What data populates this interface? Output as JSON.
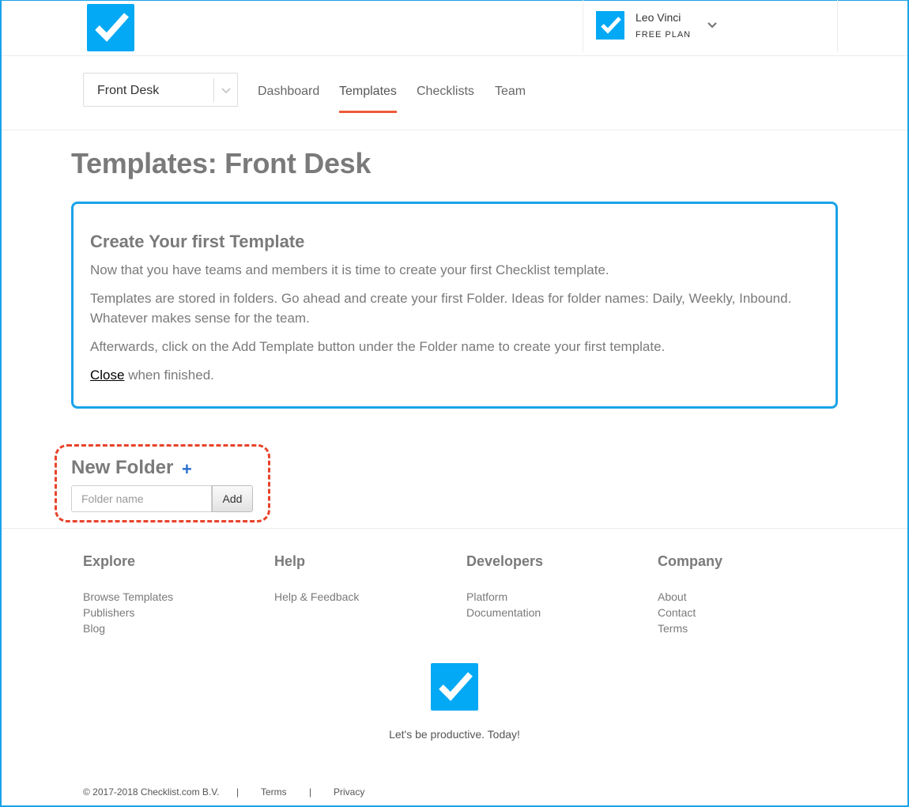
{
  "header": {
    "logo_icon": "checkmark-logo-icon",
    "user": {
      "name": "Leo Vinci",
      "plan": "FREE PLAN"
    }
  },
  "subnav": {
    "team_select": {
      "value": "Front Desk"
    },
    "tabs": [
      {
        "label": "Dashboard",
        "active": false
      },
      {
        "label": "Templates",
        "active": true
      },
      {
        "label": "Checklists",
        "active": false
      },
      {
        "label": "Team",
        "active": false
      }
    ]
  },
  "page": {
    "title": "Templates: Front Desk"
  },
  "info": {
    "title": "Create Your first Template",
    "p1": "Now that you have teams and members it is time to create your first Checklist template.",
    "p2": "Templates are stored in folders. Go ahead and create your first Folder. Ideas for folder names: Daily, Weekly, Inbound. Whatever makes sense for the team.",
    "p3": "Afterwards, click on the Add Template button under the Folder name to create your first template.",
    "close_link": "Close",
    "close_suffix": " when finished."
  },
  "new_folder": {
    "title": "New Folder",
    "plus": "+",
    "input_placeholder": "Folder name",
    "add_label": "Add"
  },
  "footer": {
    "columns": [
      {
        "title": "Explore",
        "links": [
          "Browse Templates",
          "Publishers",
          "Blog"
        ]
      },
      {
        "title": "Help",
        "links": [
          "Help & Feedback"
        ]
      },
      {
        "title": "Developers",
        "links": [
          "Platform",
          "Documentation"
        ]
      },
      {
        "title": "Company",
        "links": [
          "About",
          "Contact",
          "Terms"
        ]
      }
    ],
    "tagline": "Let's be productive. Today!",
    "copyright": "© 2017-2018 Checklist.com B.V.",
    "separator": "|",
    "terms": "Terms",
    "privacy": "Privacy"
  },
  "colors": {
    "brand": "#03a9f4",
    "accent": "#f05a3a",
    "highlight": "#e8432a",
    "frame": "#1aa3e8"
  }
}
